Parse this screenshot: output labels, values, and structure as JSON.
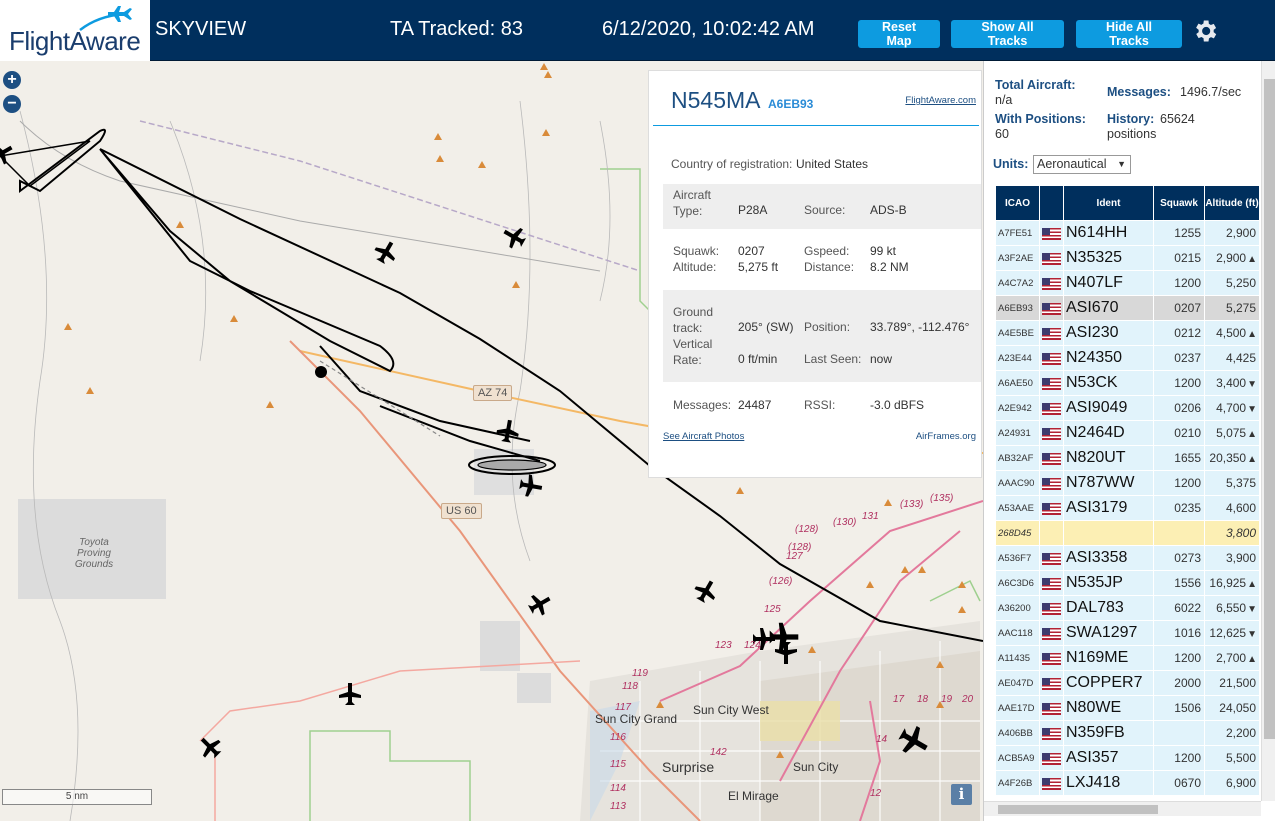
{
  "header": {
    "logo_text": "FlightAware",
    "app_title": "SKYVIEW",
    "tracked": "TA Tracked: 83",
    "clock": "6/12/2020, 10:02:42 AM",
    "buttons": {
      "reset": "Reset Map",
      "show_all": "Show All Tracks",
      "hide_all": "Hide All Tracks"
    },
    "colors": {
      "header_bg": "#002f5d",
      "button_bg": "#0d9be0"
    }
  },
  "map": {
    "zoom_in": "+",
    "zoom_out": "−",
    "scale_label": "5 nm",
    "info": "i",
    "labels": {
      "toyota": "Toyota Proving Grounds",
      "sun_city_grand": "Sun City Grand",
      "sun_city_west": "Sun City West",
      "surprise": "Surprise",
      "sun_city": "Sun City",
      "el_mirage": "El Mirage"
    },
    "shields": {
      "az74": "AZ 74",
      "us60": "US 60"
    },
    "route_numbers": [
      "(135)",
      "(133)",
      "131",
      "(130)",
      "(128)",
      "(128)",
      "127",
      "(126)",
      "125",
      "124",
      "123",
      "119",
      "118",
      "117",
      "116",
      "115",
      "114",
      "113",
      "142",
      "12",
      "14",
      "17",
      "18",
      "19",
      "20"
    ]
  },
  "selected": {
    "callsign": "N545MA",
    "icao": "A6EB93",
    "fa_link": "FlightAware.com",
    "country_label": "Country of registration:",
    "country": "United States",
    "aircraft_type_label": "Aircraft Type:",
    "aircraft_type": "P28A",
    "source_label": "Source:",
    "source": "ADS-B",
    "squawk_label": "Squawk:",
    "squawk": "0207",
    "altitude_label": "Altitude:",
    "altitude": "5,275 ft",
    "gspeed_label": "Gspeed:",
    "gspeed": "99 kt",
    "distance_label": "Distance:",
    "distance": "8.2 NM",
    "track_label": "Ground track:",
    "track": "205° (SW)",
    "position_label": "Position:",
    "position": "33.789°, -112.476°",
    "vrate_label": "Vertical Rate:",
    "vrate": "0 ft/min",
    "lastseen_label": "Last Seen:",
    "lastseen": "now",
    "messages_label": "Messages:",
    "messages": "24487",
    "rssi_label": "RSSI:",
    "rssi": "-3.0 dBFS",
    "photos_link": "See Aircraft Photos",
    "airframes_link": "AirFrames.org"
  },
  "sidebar": {
    "total_label": "Total Aircraft:",
    "total": "n/a",
    "messages_label": "Messages:",
    "messages": "1496.7/sec",
    "positions_label": "With Positions:",
    "positions": "60",
    "history_label": "History:",
    "history": "65624 positions",
    "units_label": "Units:",
    "units_value": "Aeronautical",
    "columns": [
      "ICAO",
      "",
      "Ident",
      "Squawk",
      "Altitude (ft)"
    ],
    "rows": [
      {
        "icao": "A7FE51",
        "ident": "N614HH",
        "squawk": "1255",
        "alt": "2,900",
        "trend": ""
      },
      {
        "icao": "A3F2AE",
        "ident": "N35325",
        "squawk": "0215",
        "alt": "2,900",
        "trend": "▲"
      },
      {
        "icao": "A4C7A2",
        "ident": "N407LF",
        "squawk": "1200",
        "alt": "5,250",
        "trend": ""
      },
      {
        "icao": "A6EB93",
        "ident": "ASI670",
        "squawk": "0207",
        "alt": "5,275",
        "trend": "",
        "selected": true
      },
      {
        "icao": "A4E5BE",
        "ident": "ASI230",
        "squawk": "0212",
        "alt": "4,500",
        "trend": "▲"
      },
      {
        "icao": "A23E44",
        "ident": "N24350",
        "squawk": "0237",
        "alt": "4,425",
        "trend": ""
      },
      {
        "icao": "A6AE50",
        "ident": "N53CK",
        "squawk": "1200",
        "alt": "3,400",
        "trend": "▼"
      },
      {
        "icao": "A2E942",
        "ident": "ASI9049",
        "squawk": "0206",
        "alt": "4,700",
        "trend": "▼"
      },
      {
        "icao": "A24931",
        "ident": "N2464D",
        "squawk": "0210",
        "alt": "5,075",
        "trend": "▲"
      },
      {
        "icao": "AB32AF",
        "ident": "N820UT",
        "squawk": "1655",
        "alt": "20,350",
        "trend": "▲"
      },
      {
        "icao": "AAAC90",
        "ident": "N787WW",
        "squawk": "1200",
        "alt": "5,375",
        "trend": ""
      },
      {
        "icao": "A53AAE",
        "ident": "ASI3179",
        "squawk": "0235",
        "alt": "4,600",
        "trend": ""
      },
      {
        "icao": "268D45",
        "ident": "",
        "squawk": "",
        "alt": "3,800",
        "trend": "",
        "noflag": true
      },
      {
        "icao": "A536F7",
        "ident": "ASI3358",
        "squawk": "0273",
        "alt": "3,900",
        "trend": ""
      },
      {
        "icao": "A6C3D6",
        "ident": "N535JP",
        "squawk": "1556",
        "alt": "16,925",
        "trend": "▲"
      },
      {
        "icao": "A36200",
        "ident": "DAL783",
        "squawk": "6022",
        "alt": "6,550",
        "trend": "▼"
      },
      {
        "icao": "AAC118",
        "ident": "SWA1297",
        "squawk": "1016",
        "alt": "12,625",
        "trend": "▼"
      },
      {
        "icao": "A11435",
        "ident": "N169ME",
        "squawk": "1200",
        "alt": "2,700",
        "trend": "▲"
      },
      {
        "icao": "AE047D",
        "ident": "COPPER7",
        "squawk": "2000",
        "alt": "21,500",
        "trend": ""
      },
      {
        "icao": "AAE17D",
        "ident": "N80WE",
        "squawk": "1506",
        "alt": "24,050",
        "trend": ""
      },
      {
        "icao": "A406BB",
        "ident": "N359FB",
        "squawk": "",
        "alt": "2,200",
        "trend": ""
      },
      {
        "icao": "ACB5A9",
        "ident": "ASI357",
        "squawk": "1200",
        "alt": "5,500",
        "trend": ""
      },
      {
        "icao": "A4F26B",
        "ident": "LXJ418",
        "squawk": "0670",
        "alt": "6,900",
        "trend": ""
      }
    ]
  }
}
